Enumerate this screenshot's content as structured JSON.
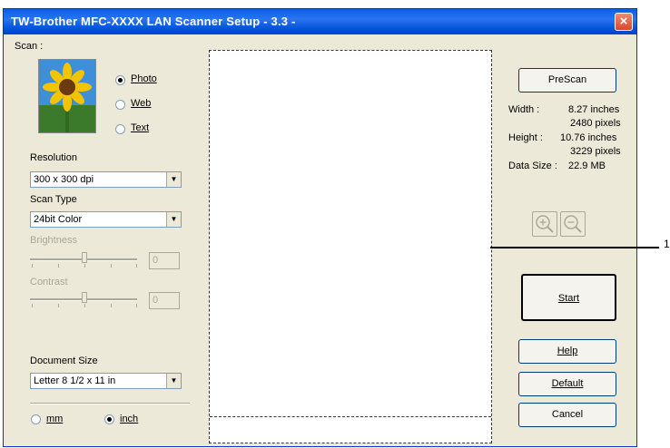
{
  "window": {
    "title": "TW-Brother MFC-XXXX LAN Scanner Setup - 3.3 -",
    "close_label": "×"
  },
  "scan": {
    "label": "Scan :",
    "options": [
      {
        "label": "Photo",
        "selected": true
      },
      {
        "label": "Web",
        "selected": false
      },
      {
        "label": "Text",
        "selected": false
      }
    ],
    "thumbnail_icon": "sunflower-image"
  },
  "resolution": {
    "label": "Resolution",
    "value": "300 x 300 dpi"
  },
  "scan_type": {
    "label": "Scan Type",
    "value": "24bit Color"
  },
  "brightness": {
    "label": "Brightness",
    "value": "0",
    "enabled": false
  },
  "contrast": {
    "label": "Contrast",
    "value": "0",
    "enabled": false
  },
  "document_size": {
    "label": "Document Size",
    "value": "Letter 8 1/2 x 11 in"
  },
  "units": [
    {
      "label": "mm",
      "selected": false
    },
    {
      "label": "inch",
      "selected": true
    }
  ],
  "prescan_label": "PreScan",
  "info": {
    "width_label": "Width :",
    "width_inches": "8.27 inches",
    "width_pixels": "2480 pixels",
    "height_label": "Height :",
    "height_inches": "10.76 inches",
    "height_pixels": "3229 pixels",
    "datasize_label": "Data Size :",
    "datasize_value": "22.9 MB"
  },
  "zoom_in_icon": "zoom-in-icon",
  "zoom_out_icon": "zoom-out-icon",
  "buttons": {
    "start": "Start",
    "help": "Help",
    "default": "Default",
    "cancel": "Cancel"
  },
  "callout": "1"
}
